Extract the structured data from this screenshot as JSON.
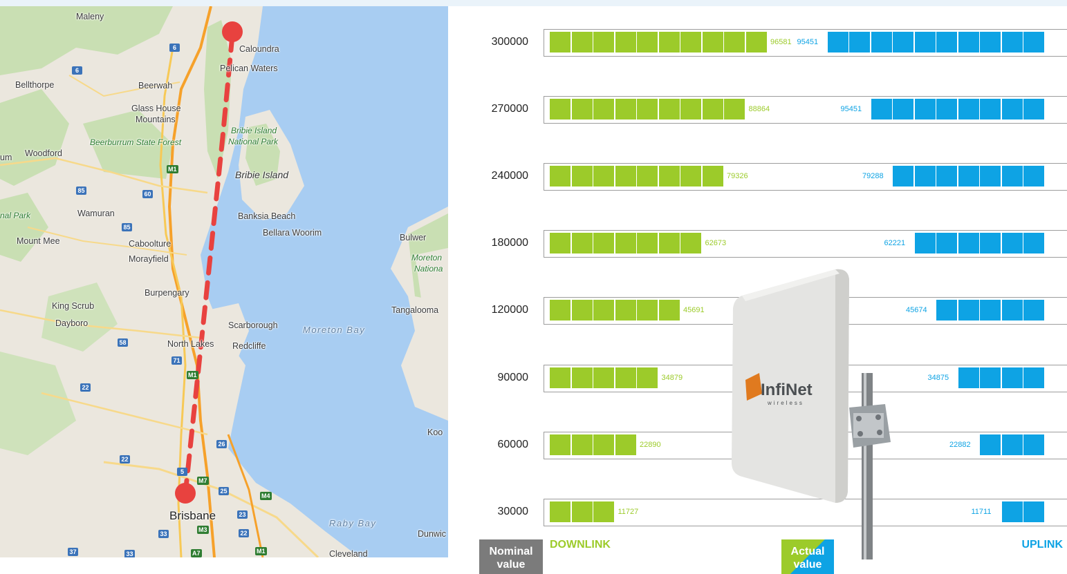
{
  "map": {
    "places": [
      {
        "id": "maleny",
        "text": "Maleny"
      },
      {
        "id": "caloundra",
        "text": "Caloundra"
      },
      {
        "id": "pelican",
        "text": "Pelican Waters"
      },
      {
        "id": "bellthorpe",
        "text": "Bellthorpe"
      },
      {
        "id": "beerwah",
        "text": "Beerwah"
      },
      {
        "id": "glasshouse",
        "text": "Glass House"
      },
      {
        "id": "mountains",
        "text": "Mountains"
      },
      {
        "id": "beerburrum",
        "text": "Beerburrum State Forest"
      },
      {
        "id": "bribienp1",
        "text": "Bribie Island"
      },
      {
        "id": "bribienp2",
        "text": "National Park"
      },
      {
        "id": "woodford",
        "text": "Woodford"
      },
      {
        "id": "um",
        "text": "um"
      },
      {
        "id": "bribie",
        "text": "Bribie Island"
      },
      {
        "id": "natpark",
        "text": "nal Park"
      },
      {
        "id": "wamuran",
        "text": "Wamuran"
      },
      {
        "id": "banksia",
        "text": "Banksia Beach"
      },
      {
        "id": "bellara",
        "text": "Bellara Woorim"
      },
      {
        "id": "mountmee",
        "text": "Mount Mee"
      },
      {
        "id": "caboolture",
        "text": "Caboolture"
      },
      {
        "id": "morayfield",
        "text": "Morayfield"
      },
      {
        "id": "bulwer",
        "text": "Bulwer"
      },
      {
        "id": "moreton1",
        "text": "Moreton"
      },
      {
        "id": "moreton2",
        "text": "Nationa"
      },
      {
        "id": "burpengary",
        "text": "Burpengary"
      },
      {
        "id": "kingscrub",
        "text": "King Scrub"
      },
      {
        "id": "tangalooma",
        "text": "Tangalooma"
      },
      {
        "id": "dayboro",
        "text": "Dayboro"
      },
      {
        "id": "scarborough",
        "text": "Scarborough"
      },
      {
        "id": "moretonbay",
        "text": "Moreton Bay"
      },
      {
        "id": "northlakes",
        "text": "North Lakes"
      },
      {
        "id": "redcliffe",
        "text": "Redcliffe"
      },
      {
        "id": "koo",
        "text": "Koo"
      },
      {
        "id": "brisbane",
        "text": "Brisbane"
      },
      {
        "id": "rabybay",
        "text": "Raby Bay"
      },
      {
        "id": "cleveland",
        "text": "Cleveland"
      },
      {
        "id": "dunwic",
        "text": "Dunwic"
      }
    ],
    "shields": [
      {
        "id": "s6a",
        "text": "6",
        "type": "blue"
      },
      {
        "id": "s6b",
        "text": "6",
        "type": "blue"
      },
      {
        "id": "sm1a",
        "text": "M1",
        "type": "green"
      },
      {
        "id": "s85a",
        "text": "85",
        "type": "blue"
      },
      {
        "id": "s60",
        "text": "60",
        "type": "blue"
      },
      {
        "id": "s85b",
        "text": "85",
        "type": "blue"
      },
      {
        "id": "s58",
        "text": "58",
        "type": "blue"
      },
      {
        "id": "s71",
        "text": "71",
        "type": "blue"
      },
      {
        "id": "sm1b",
        "text": "M1",
        "type": "green"
      },
      {
        "id": "s22a",
        "text": "22",
        "type": "blue"
      },
      {
        "id": "s26",
        "text": "26",
        "type": "blue"
      },
      {
        "id": "s22b",
        "text": "22",
        "type": "blue"
      },
      {
        "id": "s5",
        "text": "5",
        "type": "blue"
      },
      {
        "id": "sm7",
        "text": "M7",
        "type": "green"
      },
      {
        "id": "s25",
        "text": "25",
        "type": "blue"
      },
      {
        "id": "sm4",
        "text": "M4",
        "type": "green"
      },
      {
        "id": "s23",
        "text": "23",
        "type": "blue"
      },
      {
        "id": "s33a",
        "text": "33",
        "type": "blue"
      },
      {
        "id": "sm3",
        "text": "M3",
        "type": "green"
      },
      {
        "id": "s22c",
        "text": "22",
        "type": "blue"
      },
      {
        "id": "s37",
        "text": "37",
        "type": "blue"
      },
      {
        "id": "s33b",
        "text": "33",
        "type": "blue"
      },
      {
        "id": "sa7",
        "text": "A7",
        "type": "green"
      },
      {
        "id": "sm1c",
        "text": "M1",
        "type": "green"
      }
    ]
  },
  "chart": {
    "rows": [
      {
        "nominal": "300000",
        "down": "96581",
        "up": "95451",
        "down_squares": 10,
        "up_squares": 10
      },
      {
        "nominal": "270000",
        "down": "88864",
        "up": "95451",
        "down_squares": 9,
        "up_squares": 8
      },
      {
        "nominal": "240000",
        "down": "79326",
        "up": "79288",
        "down_squares": 8,
        "up_squares": 7
      },
      {
        "nominal": "180000",
        "down": "62673",
        "up": "62221",
        "down_squares": 7,
        "up_squares": 6
      },
      {
        "nominal": "120000",
        "down": "45691",
        "up": "45674",
        "down_squares": 6,
        "up_squares": 5
      },
      {
        "nominal": "90000",
        "down": "34879",
        "up": "34875",
        "down_squares": 5,
        "up_squares": 4
      },
      {
        "nominal": "60000",
        "down": "22890",
        "up": "22882",
        "down_squares": 4,
        "up_squares": 3
      },
      {
        "nominal": "30000",
        "down": "11727",
        "up": "11711",
        "down_squares": 3,
        "up_squares": 2
      }
    ],
    "legend": {
      "nominal_line1": "Nominal",
      "nominal_line2": "value",
      "actual_line1": "Actual",
      "actual_line2": "value",
      "downlink": "DOWNLINK",
      "uplink": "UPLINK"
    },
    "colors": {
      "downlink": "#9ccb2a",
      "uplink": "#0ea3e4",
      "nominal": "#7b7b7b"
    },
    "device": {
      "brand": "InfiNet",
      "sub": "wireless"
    }
  }
}
